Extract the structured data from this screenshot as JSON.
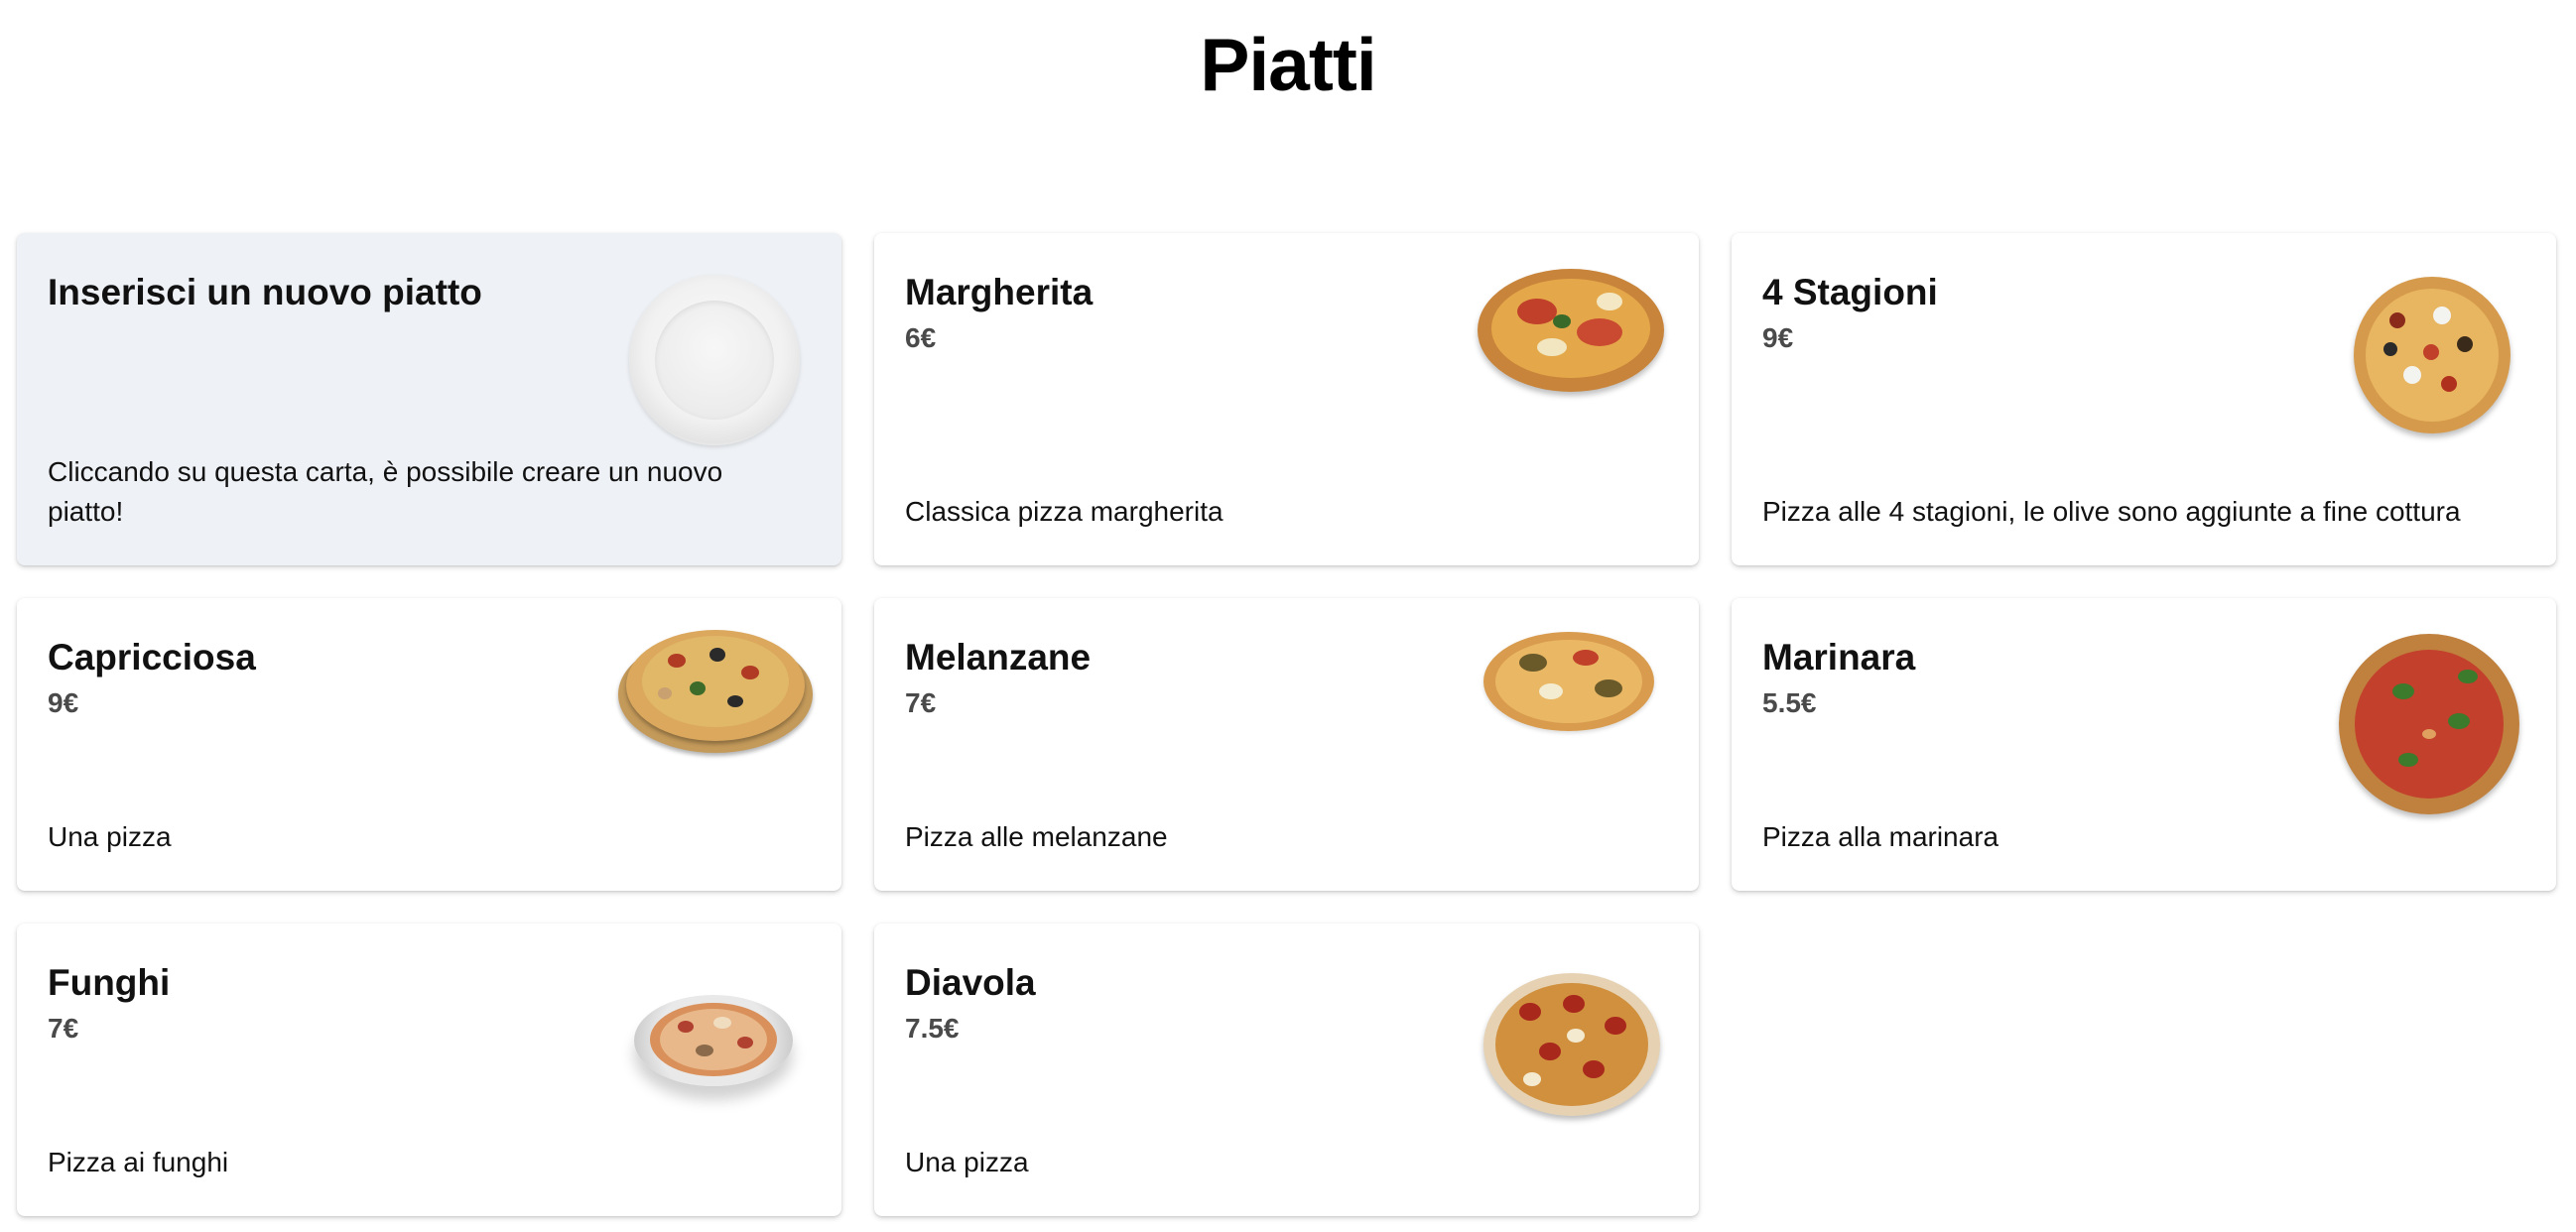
{
  "header": {
    "title": "Piatti"
  },
  "new_card": {
    "title": "Inserisci un nuovo piatto",
    "description": "Cliccando su questa carta, è possibile creare un nuovo piatto!",
    "icon": "plate-icon"
  },
  "dishes": [
    {
      "name": "Margherita",
      "price": "6€",
      "description": "Classica pizza margherita",
      "icon": "pizza-image"
    },
    {
      "name": "4 Stagioni",
      "price": "9€",
      "description": "Pizza alle 4 stagioni, le olive sono aggiunte a fine cottura",
      "icon": "pizza-image"
    },
    {
      "name": "Capricciosa",
      "price": "9€",
      "description": "Una pizza",
      "icon": "pizza-image"
    },
    {
      "name": "Melanzane",
      "price": "7€",
      "description": "Pizza alle melanzane",
      "icon": "pizza-image"
    },
    {
      "name": "Marinara",
      "price": "5.5€",
      "description": "Pizza alla marinara",
      "icon": "pizza-image"
    },
    {
      "name": "Funghi",
      "price": "7€",
      "description": "Pizza ai funghi",
      "icon": "pizza-image"
    },
    {
      "name": "Diavola",
      "price": "7.5€",
      "description": "Una pizza",
      "icon": "pizza-image"
    }
  ],
  "colors": {
    "new_card_bg": "#eef1f5",
    "card_bg": "#ffffff",
    "price_text": "#4a4a4a"
  }
}
